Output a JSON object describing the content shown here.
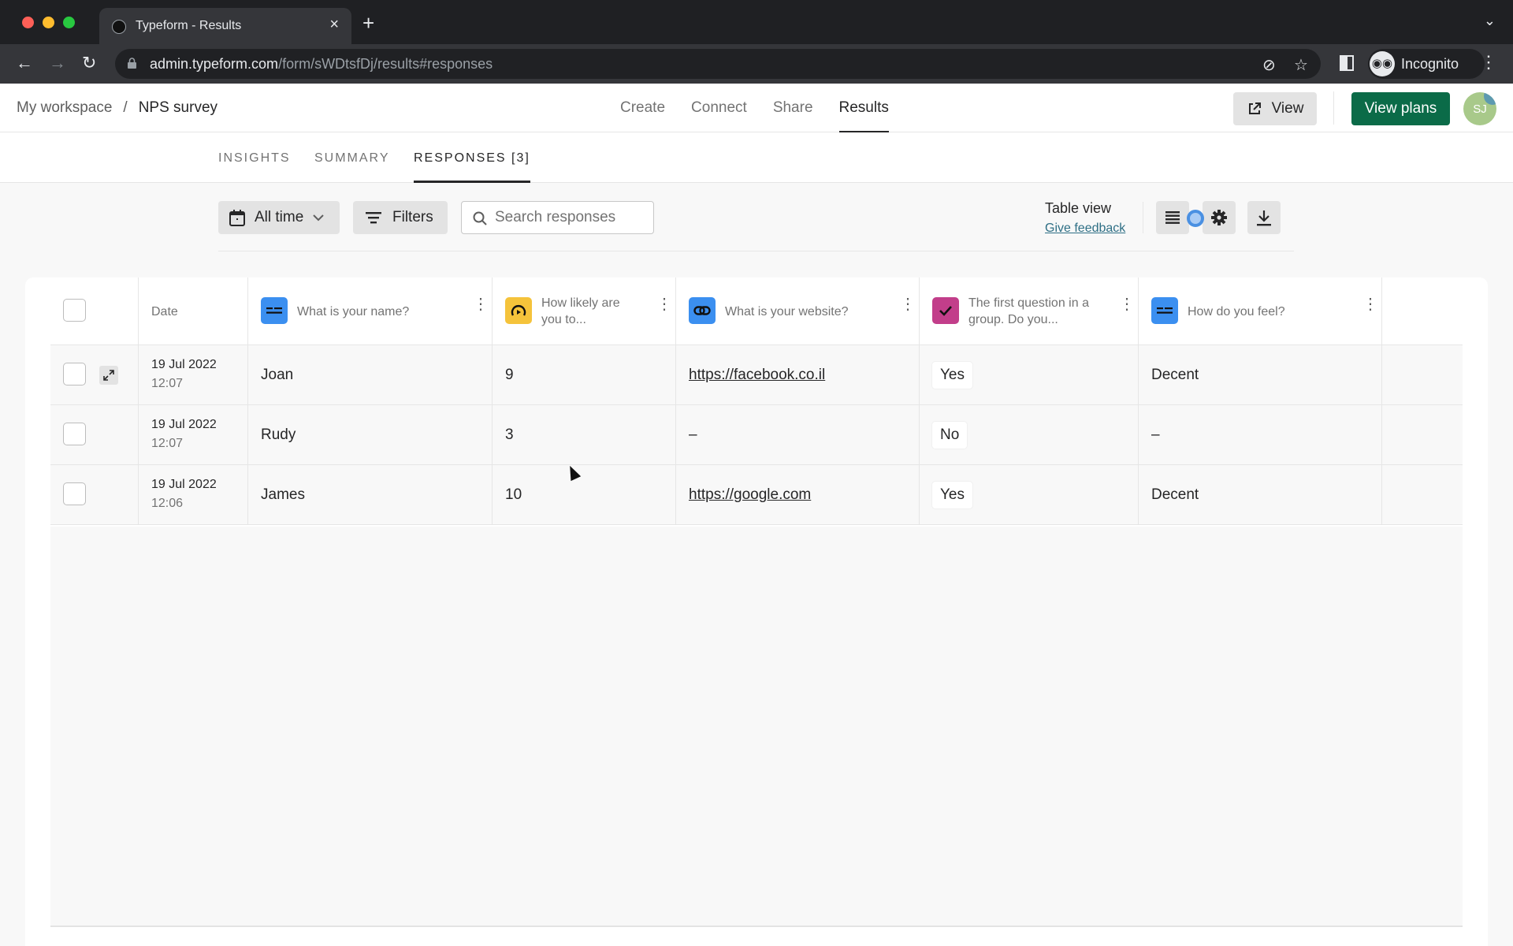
{
  "browser": {
    "tab_title": "Typeform - Results",
    "url_host": "admin.typeform.com",
    "url_path": "/form/sWDtsfDj/results#responses",
    "profile_label": "Incognito"
  },
  "appbar": {
    "breadcrumb": {
      "workspace": "My workspace",
      "separator": "/",
      "form": "NPS survey"
    },
    "nav": [
      {
        "label": "Create"
      },
      {
        "label": "Connect"
      },
      {
        "label": "Share"
      },
      {
        "label": "Results",
        "active": true
      }
    ],
    "view_label": "View",
    "plans_label": "View plans",
    "avatar_initials": "SJ",
    "colors": {
      "plans_button": "#0b6b48"
    }
  },
  "subtabs": [
    {
      "label": "INSIGHTS"
    },
    {
      "label": "SUMMARY"
    },
    {
      "label": "RESPONSES [3]",
      "active": true
    }
  ],
  "filters": {
    "date_range": "All time",
    "filters_label": "Filters",
    "search_placeholder": "Search responses",
    "search_value": "",
    "view_mode": "Table view",
    "feedback_link": "Give feedback"
  },
  "table": {
    "columns": [
      {
        "label": "Date"
      },
      {
        "label": "What is your name?",
        "icon": "short-text-icon",
        "color": "#3b8ff0"
      },
      {
        "label": "How likely are you to...",
        "icon": "nps-gauge-icon",
        "color": "#f5c33b"
      },
      {
        "label": "What is your website?",
        "icon": "link-icon",
        "color": "#3b8ff0"
      },
      {
        "label": "The first question in a group. Do you...",
        "icon": "checkmark-icon",
        "color": "#c23e8a"
      },
      {
        "label": "How do you feel?",
        "icon": "short-text-icon",
        "color": "#3b8ff0"
      }
    ],
    "rows": [
      {
        "date": "19 Jul 2022",
        "time": "12:07",
        "name": "Joan",
        "score": "9",
        "website": "https://facebook.co.il",
        "group": "Yes",
        "feel": "Decent"
      },
      {
        "date": "19 Jul 2022",
        "time": "12:07",
        "name": "Rudy",
        "score": "3",
        "website": "–",
        "group": "No",
        "feel": "–"
      },
      {
        "date": "19 Jul 2022",
        "time": "12:06",
        "name": "James",
        "score": "10",
        "website": "https://google.com",
        "group": "Yes",
        "feel": "Decent"
      }
    ]
  }
}
